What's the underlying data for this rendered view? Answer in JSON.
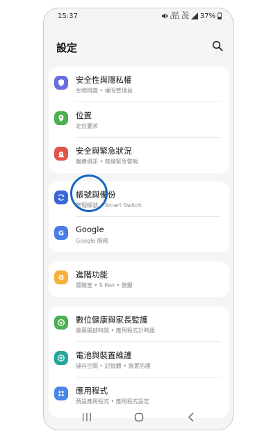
{
  "status_bar": {
    "time": "15:37",
    "vowifi_top": "Vo)",
    "vowifi_bottom": "LTE1",
    "network_top": "5G",
    "network_bottom": "LTE",
    "battery": "37%"
  },
  "header": {
    "title": "設定",
    "search_icon": "search-icon"
  },
  "groups": [
    {
      "items": [
        {
          "label": "安全性與隱私權",
          "sub": "生物辨識 • 權限管理員",
          "icon": "shield-icon",
          "color": "#6b6fe0"
        },
        {
          "label": "位置",
          "sub": "定位要求",
          "icon": "location-pin-icon",
          "color": "#4caf50"
        },
        {
          "label": "安全與緊急狀況",
          "sub": "醫療資訊 • 無線緊急警報",
          "icon": "emergency-icon",
          "color": "#e0544a"
        }
      ]
    },
    {
      "items": [
        {
          "label": "帳號與備份",
          "sub": "管理帳號 • Smart Switch",
          "icon": "sync-icon",
          "color": "#3d66d8"
        },
        {
          "label": "Google",
          "sub": "Google 服務",
          "icon": "google-icon",
          "color": "#4a7de8"
        }
      ]
    },
    {
      "items": [
        {
          "label": "進階功能",
          "sub": "實驗室 • S Pen • 側鍵",
          "icon": "gear-plus-icon",
          "color": "#f4b13c"
        }
      ]
    },
    {
      "items": [
        {
          "label": "數位健康與家長監護",
          "sub": "螢幕開啟時間 • 應用程式計時器",
          "icon": "digital-wellbeing-icon",
          "color": "#4caf50"
        },
        {
          "label": "電池與裝置維護",
          "sub": "儲存空間 • 記憶體 • 裝置防護",
          "icon": "device-care-icon",
          "color": "#26a69a"
        },
        {
          "label": "應用程式",
          "sub": "預設應用程式 • 應用程式設定",
          "icon": "apps-grid-icon",
          "color": "#4a86e8"
        }
      ]
    }
  ],
  "nav_bar": {
    "recent_icon": "recents-icon",
    "home_icon": "home-icon",
    "back_icon": "back-icon"
  },
  "annotation": {
    "color": "#1565c0"
  }
}
